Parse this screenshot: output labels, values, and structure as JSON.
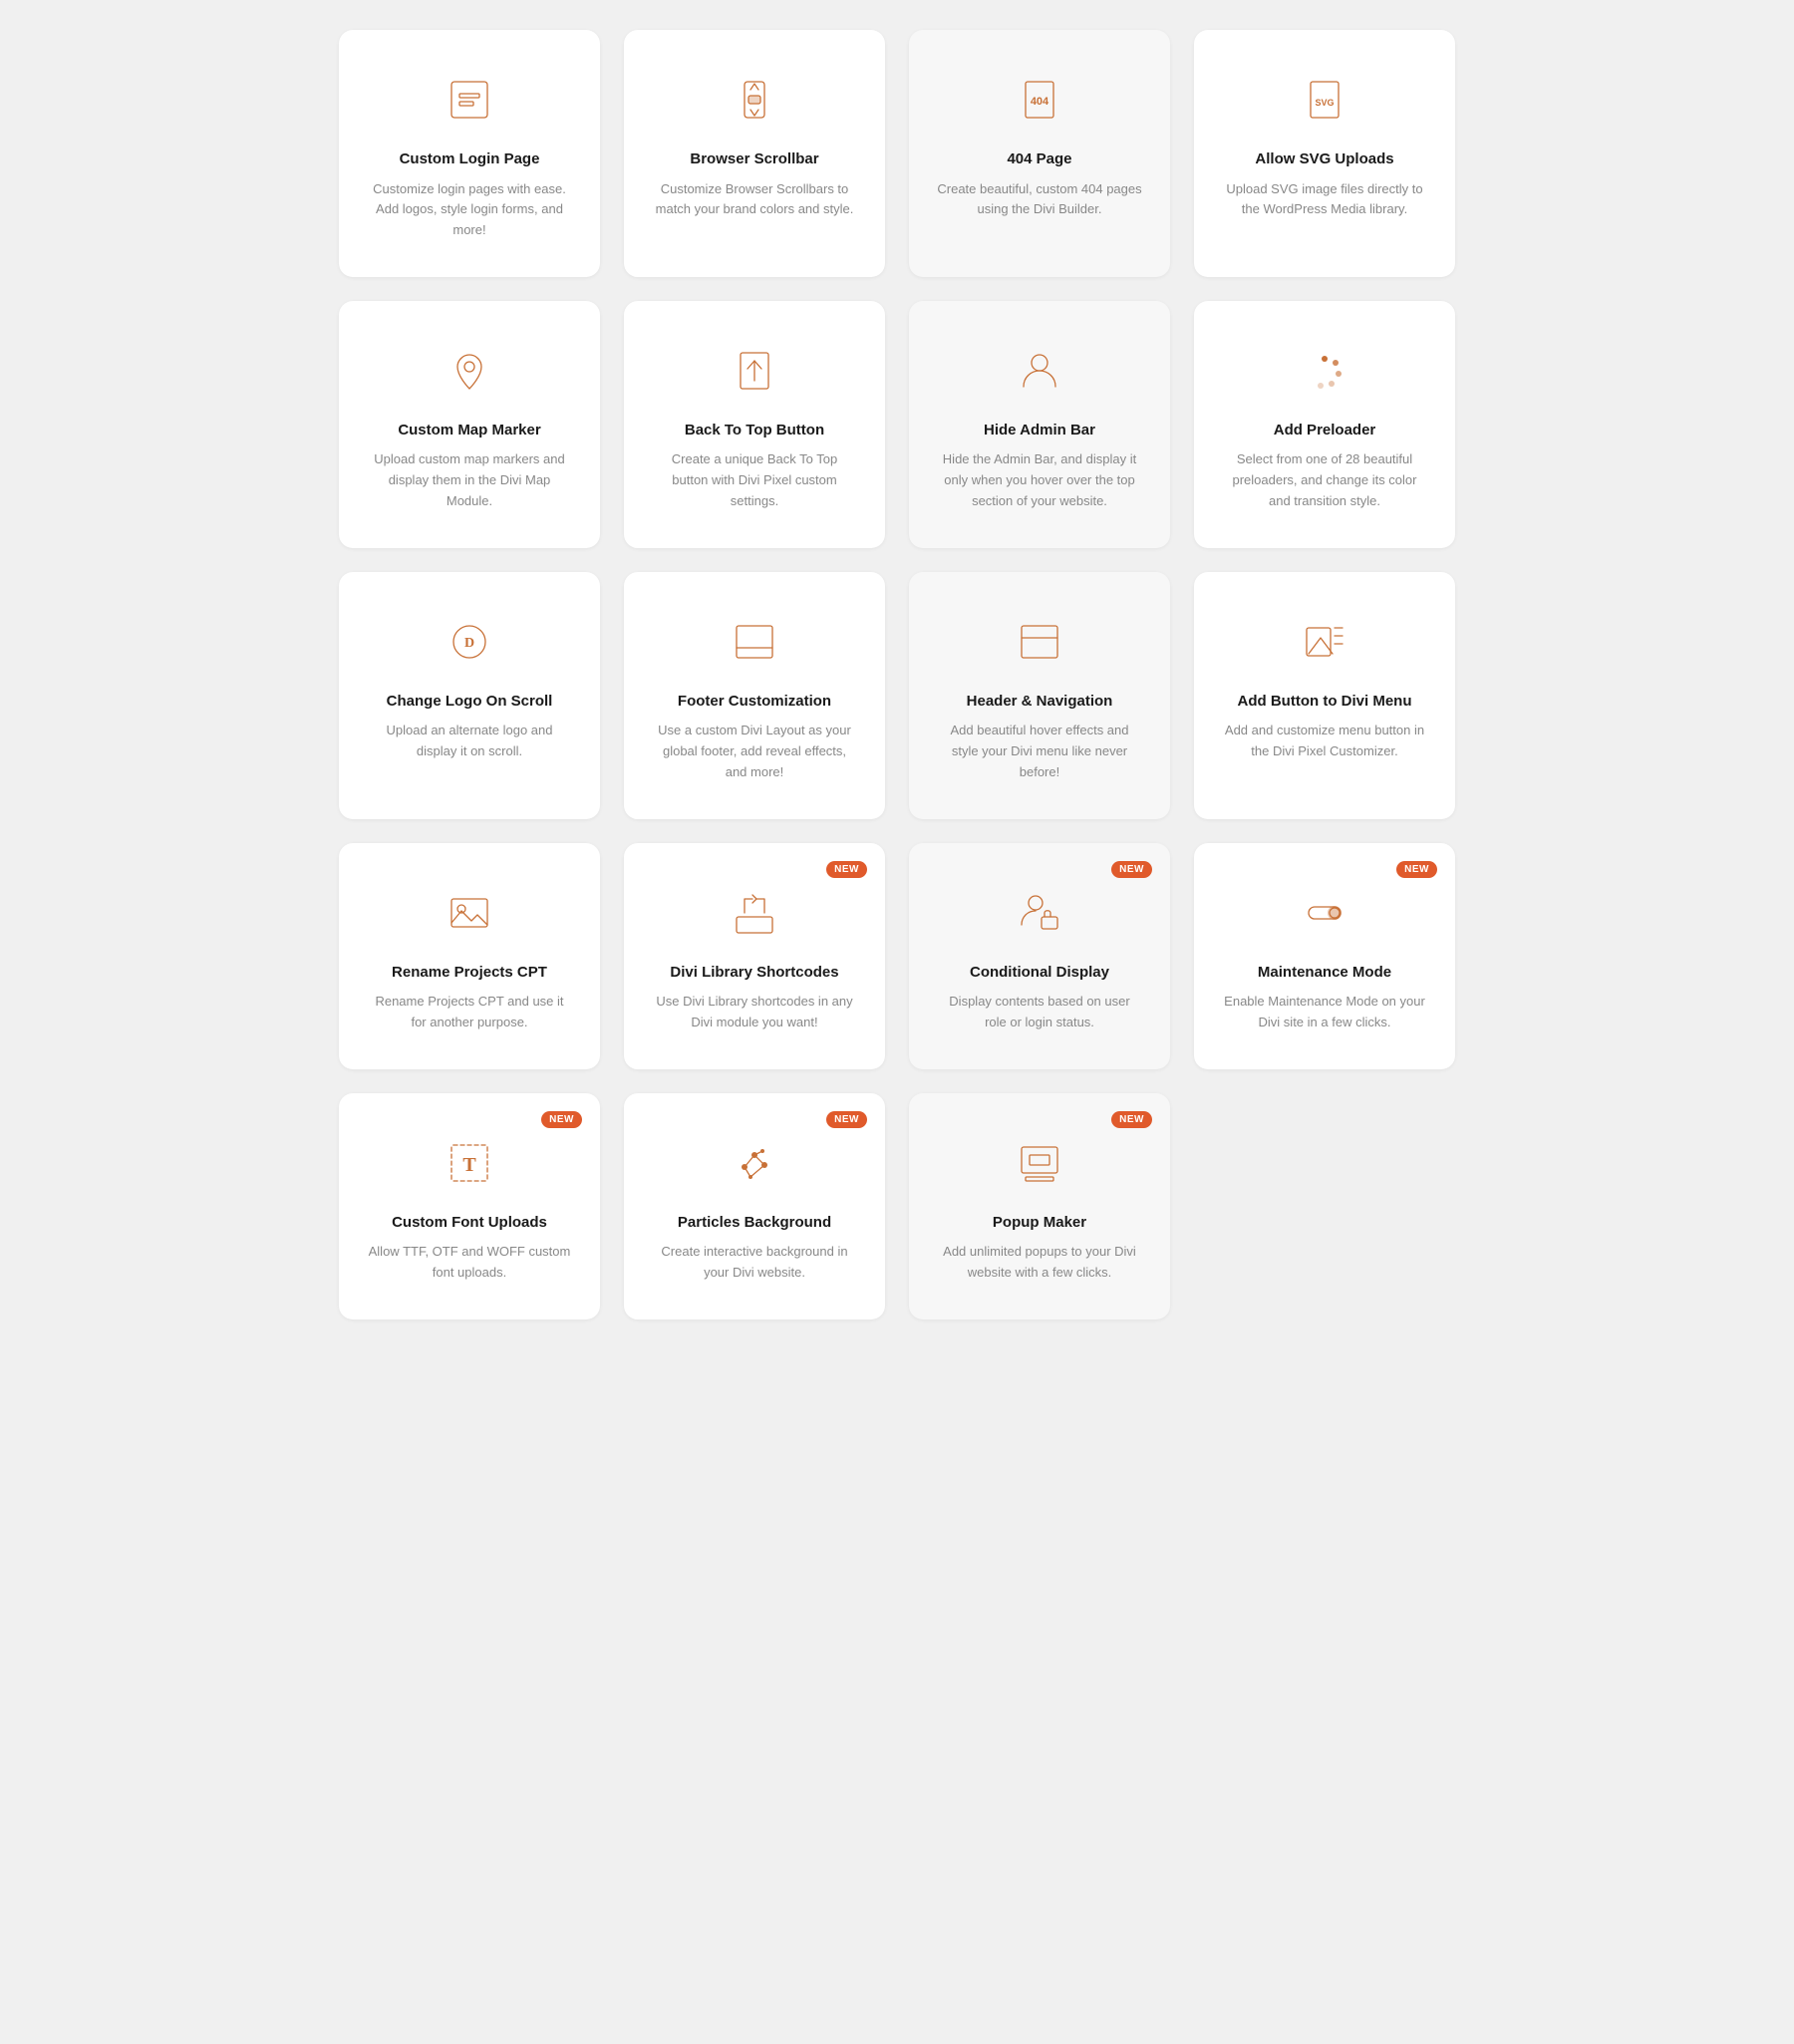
{
  "cards": [
    {
      "id": "custom-login-page",
      "title": "Custom Login Page",
      "desc": "Customize login pages with ease. Add logos, style login forms, and more!",
      "icon": "login",
      "new": false,
      "highlighted": false
    },
    {
      "id": "browser-scrollbar",
      "title": "Browser Scrollbar",
      "desc": "Customize Browser Scrollbars to match your brand colors and style.",
      "icon": "scrollbar",
      "new": false,
      "highlighted": false
    },
    {
      "id": "404-page",
      "title": "404 Page",
      "desc": "Create beautiful, custom 404 pages using the Divi Builder.",
      "icon": "404",
      "new": false,
      "highlighted": true
    },
    {
      "id": "allow-svg-uploads",
      "title": "Allow SVG Uploads",
      "desc": "Upload SVG image files directly to the WordPress Media library.",
      "icon": "svg",
      "new": false,
      "highlighted": false
    },
    {
      "id": "custom-map-marker",
      "title": "Custom Map Marker",
      "desc": "Upload custom map markers and display them in the Divi Map Module.",
      "icon": "map-marker",
      "new": false,
      "highlighted": false
    },
    {
      "id": "back-to-top-button",
      "title": "Back To Top Button",
      "desc": "Create a unique Back To Top button with Divi Pixel custom settings.",
      "icon": "back-to-top",
      "new": false,
      "highlighted": false
    },
    {
      "id": "hide-admin-bar",
      "title": "Hide Admin Bar",
      "desc": "Hide the Admin Bar, and display it only when you hover over the top section of your website.",
      "icon": "user",
      "new": false,
      "highlighted": true
    },
    {
      "id": "add-preloader",
      "title": "Add Preloader",
      "desc": "Select from one of 28 beautiful preloaders, and change its color and transition style.",
      "icon": "preloader",
      "new": false,
      "highlighted": false
    },
    {
      "id": "change-logo-on-scroll",
      "title": "Change Logo On Scroll",
      "desc": "Upload an alternate logo and display it on scroll.",
      "icon": "logo-scroll",
      "new": false,
      "highlighted": false
    },
    {
      "id": "footer-customization",
      "title": "Footer Customization",
      "desc": "Use a custom Divi Layout as your global footer, add reveal effects, and more!",
      "icon": "footer",
      "new": false,
      "highlighted": false
    },
    {
      "id": "header-navigation",
      "title": "Header & Navigation",
      "desc": "Add beautiful hover effects and style your Divi menu like never before!",
      "icon": "header-nav",
      "new": false,
      "highlighted": true
    },
    {
      "id": "add-button-divi-menu",
      "title": "Add Button to Divi Menu",
      "desc": "Add and customize menu button in the Divi Pixel Customizer.",
      "icon": "menu-button",
      "new": false,
      "highlighted": false
    },
    {
      "id": "rename-projects-cpt",
      "title": "Rename Projects CPT",
      "desc": "Rename Projects CPT and use it for another purpose.",
      "icon": "image",
      "new": false,
      "highlighted": false
    },
    {
      "id": "divi-library-shortcodes",
      "title": "Divi Library Shortcodes",
      "desc": "Use Divi Library shortcodes in any Divi module you want!",
      "icon": "shortcode",
      "new": true,
      "highlighted": false
    },
    {
      "id": "conditional-display",
      "title": "Conditional Display",
      "desc": "Display contents based on user role or login status.",
      "icon": "user-lock",
      "new": true,
      "highlighted": true
    },
    {
      "id": "maintenance-mode",
      "title": "Maintenance Mode",
      "desc": "Enable Maintenance Mode on your Divi site in a few clicks.",
      "icon": "toggle",
      "new": true,
      "highlighted": false
    },
    {
      "id": "custom-font-uploads",
      "title": "Custom Font Uploads",
      "desc": "Allow TTF, OTF and WOFF custom font uploads.",
      "icon": "font",
      "new": true,
      "highlighted": false
    },
    {
      "id": "particles-background",
      "title": "Particles Background",
      "desc": "Create interactive background in your Divi website.",
      "icon": "particles",
      "new": true,
      "highlighted": false
    },
    {
      "id": "popup-maker",
      "title": "Popup Maker",
      "desc": "Add unlimited popups to your Divi website with a few clicks.",
      "icon": "popup",
      "new": true,
      "highlighted": true
    }
  ],
  "badge_label": "NEW"
}
